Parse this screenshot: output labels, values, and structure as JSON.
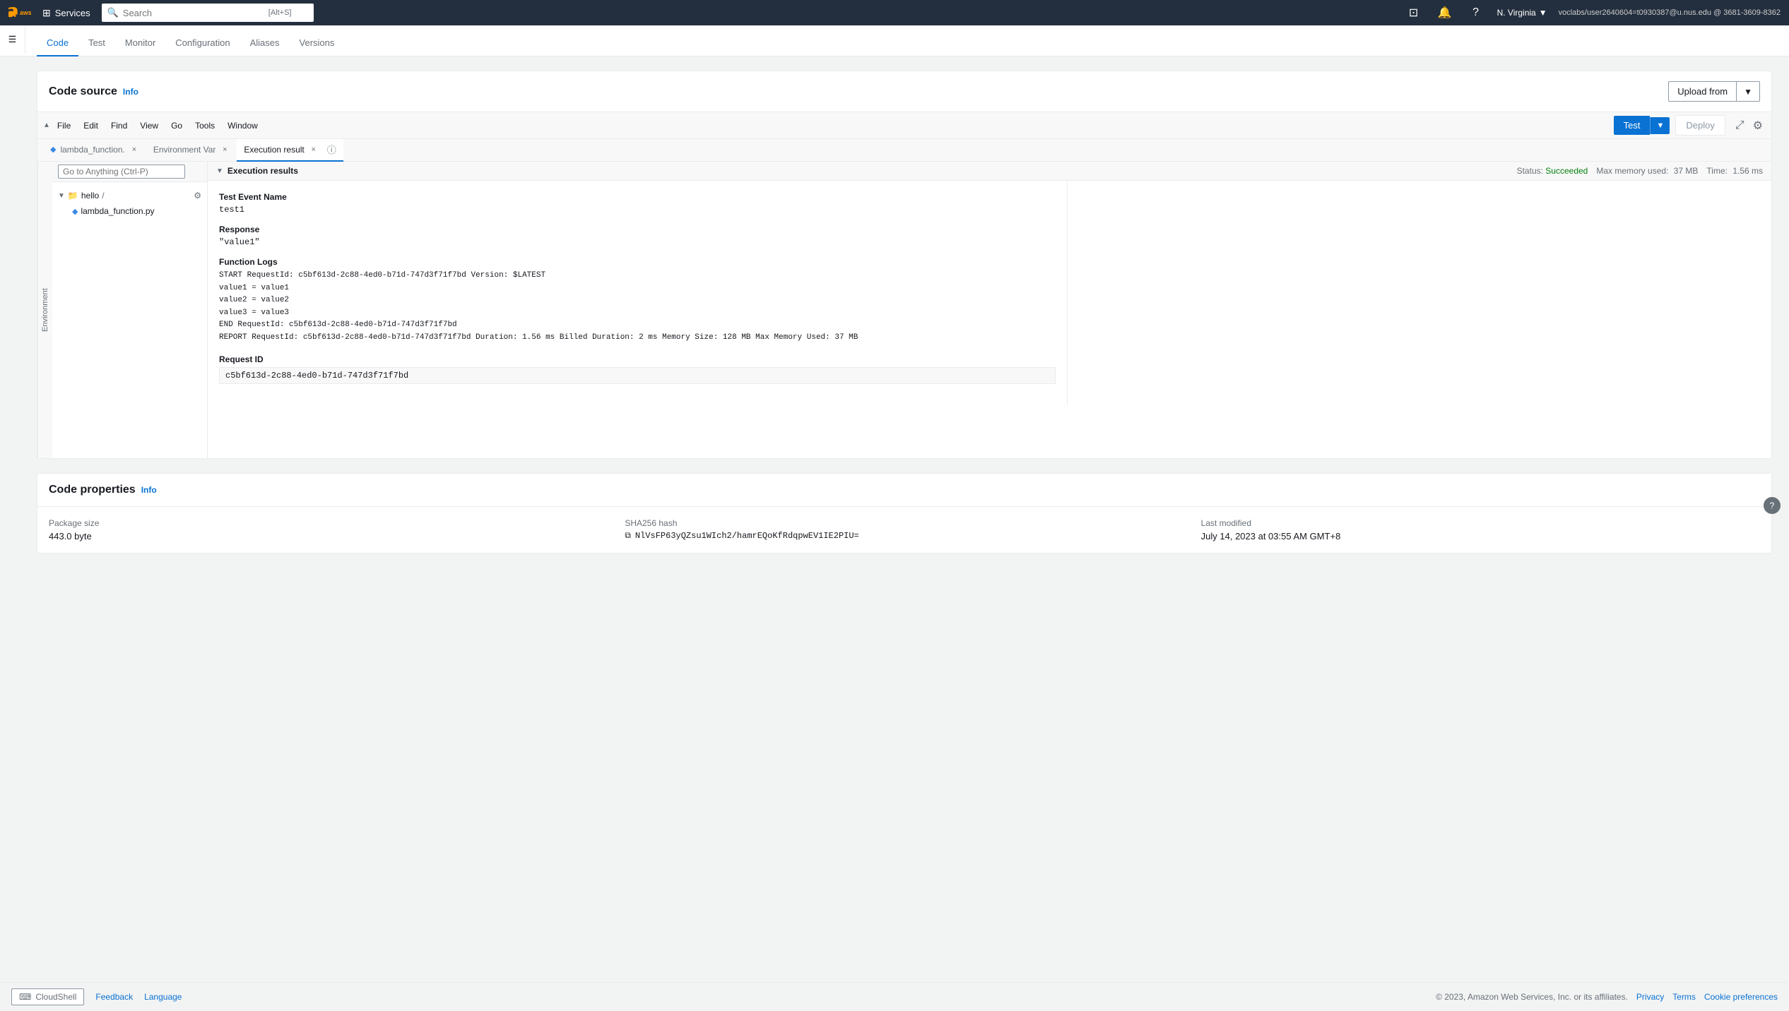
{
  "topNav": {
    "searchPlaceholder": "Search",
    "searchHint": "[Alt+S]",
    "services": "Services",
    "user": "N. Virginia",
    "userDropdown": "▼",
    "account": "voclabs/user2640604=t0930387@u.nus.edu @ 3681-3609-8362"
  },
  "tabs": {
    "items": [
      {
        "label": "Code",
        "active": true
      },
      {
        "label": "Test",
        "active": false
      },
      {
        "label": "Monitor",
        "active": false
      },
      {
        "label": "Configuration",
        "active": false
      },
      {
        "label": "Aliases",
        "active": false
      },
      {
        "label": "Versions",
        "active": false
      }
    ]
  },
  "codeSource": {
    "title": "Code source",
    "info": "Info",
    "uploadFrom": "Upload from"
  },
  "editorToolbar": {
    "file": "File",
    "edit": "Edit",
    "find": "Find",
    "view": "View",
    "go": "Go",
    "tools": "Tools",
    "window": "Window",
    "test": "Test",
    "deploy": "Deploy"
  },
  "editorTabs": {
    "items": [
      {
        "label": "lambda_function.",
        "hasClose": true,
        "active": false
      },
      {
        "label": "Environment Var",
        "hasClose": true,
        "active": false
      },
      {
        "label": "Execution result",
        "hasClose": true,
        "active": true
      }
    ]
  },
  "editorLeft": {
    "label": "Environment",
    "searchPlaceholder": "Go to Anything (Ctrl-P)",
    "folder": "hello",
    "folderSuffix": "/",
    "file": "lambda_function.py"
  },
  "executionResults": {
    "title": "Execution results",
    "status": {
      "label": "Status:",
      "value": "Succeeded"
    },
    "maxMemory": {
      "label": "Max memory used:",
      "value": "37 MB"
    },
    "time": {
      "label": "Time:",
      "value": "1.56 ms"
    },
    "testEventName": {
      "title": "Test Event Name",
      "value": "test1"
    },
    "response": {
      "title": "Response",
      "value": "\"value1\""
    },
    "functionLogs": {
      "title": "Function Logs",
      "lines": [
        "START RequestId: c5bf613d-2c88-4ed0-b71d-747d3f71f7bd Version: $LATEST",
        "value1 = value1",
        "value2 = value2",
        "value3 = value3",
        "END RequestId: c5bf613d-2c88-4ed0-b71d-747d3f71f7bd",
        "REPORT RequestId: c5bf613d-2c88-4ed0-b71d-747d3f71f7bd  Duration: 1.56 ms   Billed Duration: 2 ms   Memory Size: 128 MB Max Memory Used: 37 MB"
      ]
    },
    "requestId": {
      "title": "Request ID",
      "value": "c5bf613d-2c88-4ed0-b71d-747d3f71f7bd"
    }
  },
  "codeProperties": {
    "title": "Code properties",
    "info": "Info",
    "packageSize": {
      "label": "Package size",
      "value": "443.0 byte"
    },
    "sha256": {
      "label": "SHA256 hash",
      "value": "NlVsFP63yQZsu1WIch2/hamrEQoKfRdqpwEV1IE2PIU="
    },
    "lastModified": {
      "label": "Last modified",
      "value": "July 14, 2023 at 03:55 AM GMT+8"
    }
  },
  "footer": {
    "cloudshell": "CloudShell",
    "feedback": "Feedback",
    "language": "Language",
    "copyright": "© 2023, Amazon Web Services, Inc. or its affiliates.",
    "privacy": "Privacy",
    "terms": "Terms",
    "cookiePreferences": "Cookie preferences"
  }
}
